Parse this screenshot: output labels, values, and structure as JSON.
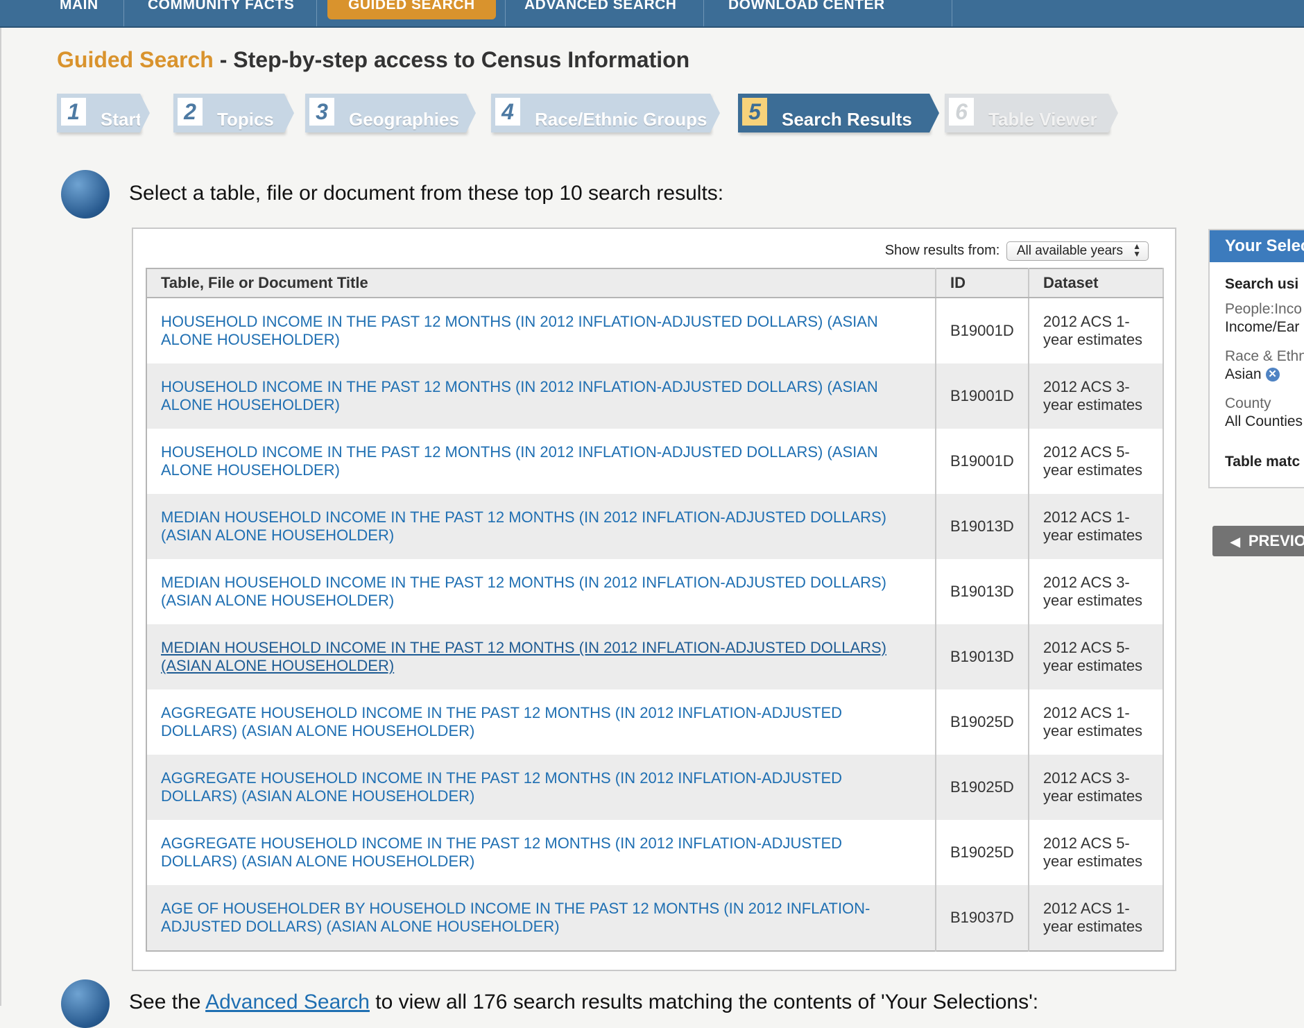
{
  "nav": {
    "items": [
      "MAIN",
      "COMMUNITY FACTS",
      "GUIDED SEARCH",
      "ADVANCED SEARCH",
      "DOWNLOAD CENTER"
    ],
    "active": "GUIDED SEARCH",
    "colors": {
      "bar": "#3c6d96",
      "active": "#d9932d"
    }
  },
  "heading": {
    "accent": "Guided Search",
    "rest": " - Step-by-step access to Census Information"
  },
  "steps": [
    {
      "num": "1",
      "label": "Start",
      "state": "done"
    },
    {
      "num": "2",
      "label": "Topics",
      "state": "done"
    },
    {
      "num": "3",
      "label": "Geographies",
      "state": "done"
    },
    {
      "num": "4",
      "label": "Race/Ethnic Groups",
      "state": "done"
    },
    {
      "num": "5",
      "label": "Search Results",
      "state": "active"
    },
    {
      "num": "6",
      "label": "Table Viewer",
      "state": "disabled"
    }
  ],
  "instruction": "Select a table, file or document from these top 10 search results:",
  "filter": {
    "label": "Show results from:",
    "value": "All available years"
  },
  "table": {
    "headers": [
      "Table, File or Document Title",
      "ID",
      "Dataset"
    ],
    "rows": [
      {
        "title": "HOUSEHOLD INCOME IN THE PAST 12 MONTHS (IN 2012 INFLATION-ADJUSTED DOLLARS) (ASIAN ALONE HOUSEHOLDER)",
        "id": "B19001D",
        "dataset": "2012 ACS 1-year estimates"
      },
      {
        "title": "HOUSEHOLD INCOME IN THE PAST 12 MONTHS (IN 2012 INFLATION-ADJUSTED DOLLARS) (ASIAN ALONE HOUSEHOLDER)",
        "id": "B19001D",
        "dataset": "2012 ACS 3-year estimates"
      },
      {
        "title": "HOUSEHOLD INCOME IN THE PAST 12 MONTHS (IN 2012 INFLATION-ADJUSTED DOLLARS) (ASIAN ALONE HOUSEHOLDER)",
        "id": "B19001D",
        "dataset": "2012 ACS 5-year estimates"
      },
      {
        "title": "MEDIAN HOUSEHOLD INCOME IN THE PAST 12 MONTHS (IN 2012 INFLATION-ADJUSTED DOLLARS) (ASIAN ALONE HOUSEHOLDER)",
        "id": "B19013D",
        "dataset": "2012 ACS 1-year estimates"
      },
      {
        "title": "MEDIAN HOUSEHOLD INCOME IN THE PAST 12 MONTHS (IN 2012 INFLATION-ADJUSTED DOLLARS) (ASIAN ALONE HOUSEHOLDER)",
        "id": "B19013D",
        "dataset": "2012 ACS 3-year estimates"
      },
      {
        "title": "MEDIAN HOUSEHOLD INCOME IN THE PAST 12 MONTHS (IN 2012 INFLATION-ADJUSTED DOLLARS) (ASIAN ALONE HOUSEHOLDER)",
        "id": "B19013D",
        "dataset": "2012 ACS 5-year estimates"
      },
      {
        "title": "AGGREGATE HOUSEHOLD INCOME IN THE PAST 12 MONTHS (IN 2012 INFLATION-ADJUSTED DOLLARS) (ASIAN ALONE HOUSEHOLDER)",
        "id": "B19025D",
        "dataset": "2012 ACS 1-year estimates"
      },
      {
        "title": "AGGREGATE HOUSEHOLD INCOME IN THE PAST 12 MONTHS (IN 2012 INFLATION-ADJUSTED DOLLARS) (ASIAN ALONE HOUSEHOLDER)",
        "id": "B19025D",
        "dataset": "2012 ACS 3-year estimates"
      },
      {
        "title": "AGGREGATE HOUSEHOLD INCOME IN THE PAST 12 MONTHS (IN 2012 INFLATION-ADJUSTED DOLLARS) (ASIAN ALONE HOUSEHOLDER)",
        "id": "B19025D",
        "dataset": "2012 ACS 5-year estimates"
      },
      {
        "title": "AGE OF HOUSEHOLDER BY HOUSEHOLD INCOME IN THE PAST 12 MONTHS (IN 2012 INFLATION-ADJUSTED DOLLARS) (ASIAN ALONE HOUSEHOLDER)",
        "id": "B19037D",
        "dataset": "2012 ACS 1-year estimates"
      }
    ],
    "hovered_row": 6
  },
  "selections": {
    "title": "Your Selec",
    "lines": [
      {
        "text": "Search usi",
        "style": "bold"
      },
      {
        "text": "People:Inco",
        "style": "muted"
      },
      {
        "text": "Income/Ear",
        "style": "normal"
      },
      {
        "text": "Race & Ethn",
        "style": "muted"
      },
      {
        "text": "Asian",
        "style": "normal",
        "removable": true
      },
      {
        "text": "County",
        "style": "muted"
      },
      {
        "text": "All Counties",
        "style": "normal"
      },
      {
        "text": "Table matc",
        "style": "bold"
      }
    ]
  },
  "previous_button": "PREVIO",
  "bottom_note": {
    "before": "See the ",
    "link": "Advanced Search",
    "after": " to view all 176 search results matching the contents of 'Your Selections':"
  }
}
